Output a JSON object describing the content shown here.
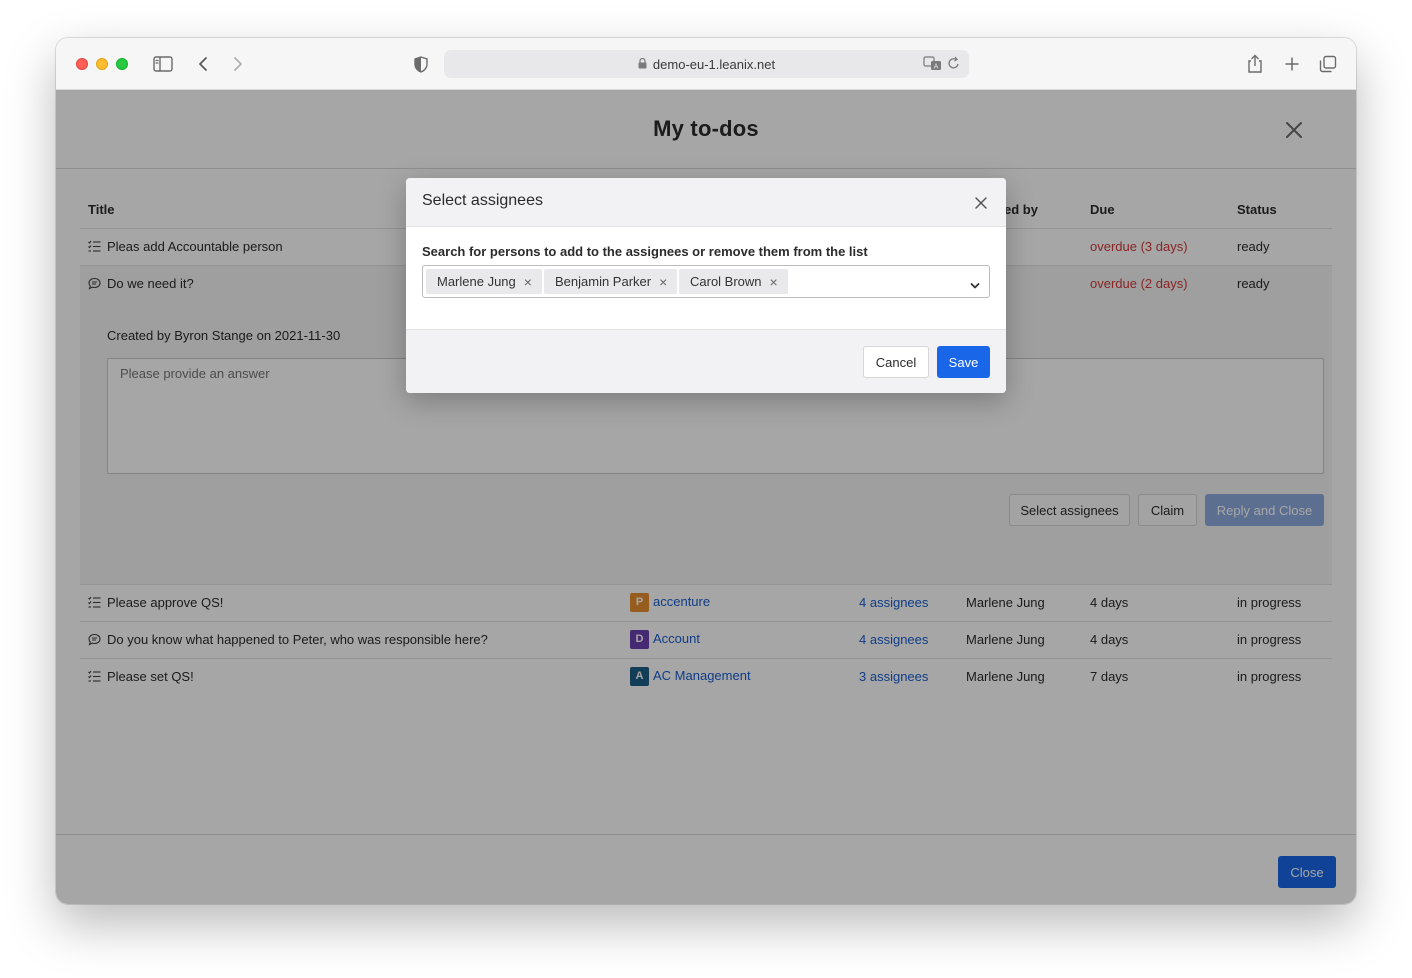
{
  "browser": {
    "url": "demo-eu-1.leanix.net"
  },
  "page": {
    "title": "My to-dos",
    "columns": {
      "title": "Title",
      "requested_by": "ed by",
      "due": "Due",
      "status": "Status"
    },
    "rows": [
      {
        "type": "checklist",
        "title": "Pleas add Accountable person",
        "due": "overdue (3 days)",
        "status": "ready"
      },
      {
        "type": "comment",
        "title": "Do we need it?",
        "due": "overdue (2 days)",
        "status": "ready"
      },
      {
        "type": "checklist",
        "title": "Please approve QS!",
        "fs_badge": "P",
        "fs_name": "accenture",
        "assignees": "4 assignees",
        "requested_by": "Marlene Jung",
        "due": "4 days",
        "status": "in progress"
      },
      {
        "type": "comment",
        "title": "Do you know what happened to Peter, who was responsible here?",
        "fs_badge": "D",
        "fs_name": "Account",
        "assignees": "4 assignees",
        "requested_by": "Marlene Jung",
        "due": "4 days",
        "status": "in progress"
      },
      {
        "type": "checklist",
        "title": "Please set QS!",
        "fs_badge": "A",
        "fs_name": "AC Management",
        "assignees": "3 assignees",
        "requested_by": "Marlene Jung",
        "due": "7 days",
        "status": "in progress"
      }
    ],
    "expanded": {
      "created_text": "Created by Byron Stange on 2021-11-30",
      "answer_placeholder": "Please provide an answer",
      "select_assignees_label": "Select assignees",
      "claim_label": "Claim",
      "reply_close_label": "Reply and Close"
    },
    "footer": {
      "close_label": "Close"
    }
  },
  "modal": {
    "title": "Select assignees",
    "instruction": "Search for persons to add to the assignees or remove them from the list",
    "selected": [
      "Marlene Jung",
      "Benjamin Parker",
      "Carol Brown"
    ],
    "cancel_label": "Cancel",
    "save_label": "Save"
  },
  "colors": {
    "primary": "#1a66e8",
    "overdue": "#d43a3a",
    "link": "#1a5fcf",
    "badge_p": "#e8902e",
    "badge_d": "#6a3fb0",
    "badge_a": "#1e5f86"
  }
}
